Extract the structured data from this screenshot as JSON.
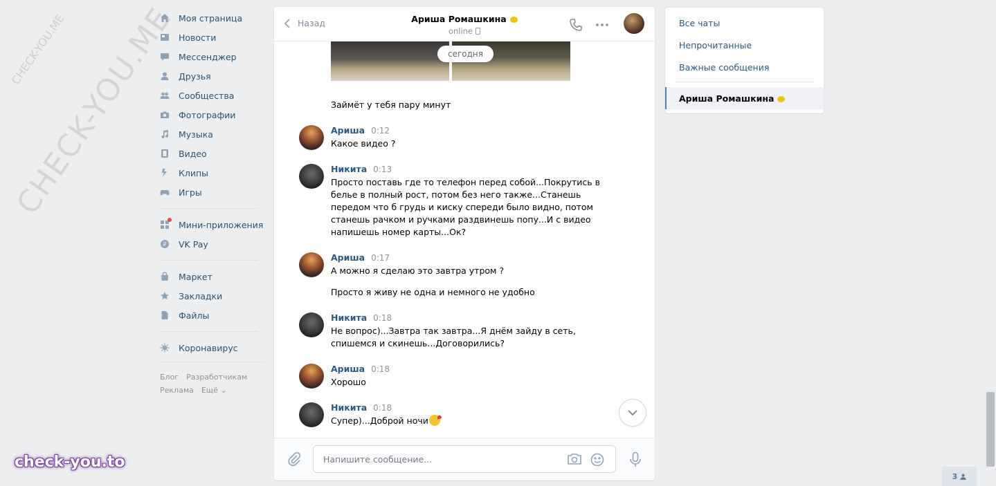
{
  "nav": {
    "items": [
      {
        "label": "Моя страница",
        "icon": "home-icon"
      },
      {
        "label": "Новости",
        "icon": "news-icon"
      },
      {
        "label": "Мессенджер",
        "icon": "messenger-icon"
      },
      {
        "label": "Друзья",
        "icon": "friends-icon"
      },
      {
        "label": "Сообщества",
        "icon": "communities-icon"
      },
      {
        "label": "Фотографии",
        "icon": "camera-icon"
      },
      {
        "label": "Музыка",
        "icon": "music-icon"
      },
      {
        "label": "Видео",
        "icon": "video-icon"
      },
      {
        "label": "Клипы",
        "icon": "clips-icon"
      },
      {
        "label": "Игры",
        "icon": "gamepad-icon"
      },
      {
        "label": "Мини-приложения",
        "icon": "apps-icon"
      },
      {
        "label": "VK Pay",
        "icon": "vkpay-icon"
      },
      {
        "label": "Маркет",
        "icon": "bag-icon"
      },
      {
        "label": "Закладки",
        "icon": "star-icon"
      },
      {
        "label": "Файлы",
        "icon": "file-icon"
      },
      {
        "label": "Коронавирус",
        "icon": "virus-icon"
      }
    ],
    "footer": [
      "Блог",
      "Разработчикам",
      "Реклама",
      "Ещё ⌄"
    ]
  },
  "chat": {
    "back_label": "Назад",
    "title": "Ариша Ромашкина",
    "status": "online",
    "date_divider": "сегодня",
    "caption": "Займёт у тебя пару минут",
    "messages": [
      {
        "author": "Ариша",
        "time": "0:12",
        "avatar": "a",
        "lines": [
          "Какое видео ?"
        ]
      },
      {
        "author": "Никита",
        "time": "0:13",
        "avatar": "n",
        "lines": [
          "Просто поставь где то телефон перед собой...Покрутись в белье в полный рост, потом без него также...Станешь передом что б грудь и киску спереди было видно, потом станешь рачком и ручками раздвинешь попу...И с видео напишешь номер карты...Ок?"
        ]
      },
      {
        "author": "Ариша",
        "time": "0:17",
        "avatar": "a",
        "lines": [
          "А можно я сделаю это завтра утром ?",
          "Просто я живу не одна и немного не удобно"
        ]
      },
      {
        "author": "Никита",
        "time": "0:18",
        "avatar": "n",
        "lines": [
          "Не вопрос)...Завтра так завтра...Я днём зайду в сеть, спишемся и скинешь...Договорились?"
        ]
      },
      {
        "author": "Ариша",
        "time": "0:18",
        "avatar": "a",
        "lines": [
          "Хорошо"
        ]
      },
      {
        "author": "Никита",
        "time": "0:18",
        "avatar": "n",
        "lines": [
          "Супер)...Доброй ночи"
        ]
      }
    ],
    "composer_placeholder": "Напишите сообщение..."
  },
  "folders": {
    "items": [
      "Все чаты",
      "Непрочитанные",
      "Важные сообщения"
    ],
    "active_chat": "Ариша Ромашкина"
  },
  "online_count": "3",
  "watermarks": {
    "big": "CHECK-YOU.ME",
    "small": "CHECK-YOU.ME",
    "logo": "check-you.to"
  },
  "colors": {
    "link": "#2a5885",
    "nav_text": "#285473",
    "background": "#edeef0",
    "accent": "#5181b8"
  }
}
